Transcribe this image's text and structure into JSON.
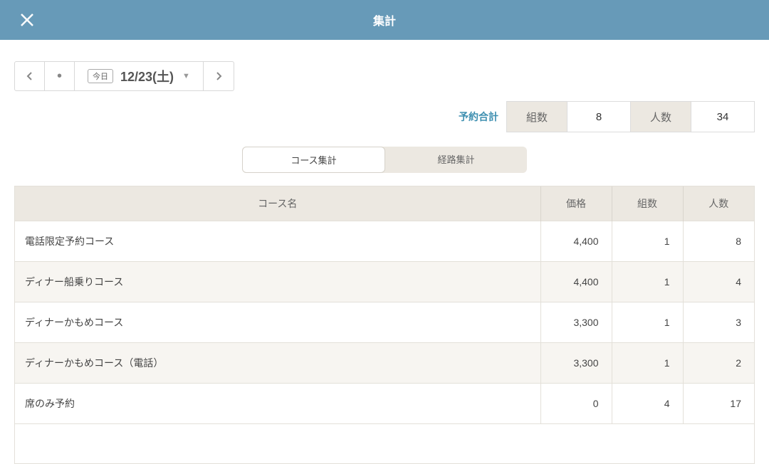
{
  "header": {
    "title": "集計"
  },
  "dateNav": {
    "todayBadge": "今日",
    "date": "12/23(土)"
  },
  "summary": {
    "label": "予約合計",
    "groupsLabel": "組数",
    "groupsValue": "8",
    "peopleLabel": "人数",
    "peopleValue": "34"
  },
  "tabs": {
    "course": "コース集計",
    "route": "経路集計"
  },
  "table": {
    "headers": {
      "courseName": "コース名",
      "price": "価格",
      "groups": "組数",
      "people": "人数"
    },
    "rows": [
      {
        "name": "電話限定予約コース",
        "price": "4,400",
        "groups": "1",
        "people": "8"
      },
      {
        "name": "ディナー船乗りコース",
        "price": "4,400",
        "groups": "1",
        "people": "4"
      },
      {
        "name": "ディナーかもめコース",
        "price": "3,300",
        "groups": "1",
        "people": "3"
      },
      {
        "name": "ディナーかもめコース（電話）",
        "price": "3,300",
        "groups": "1",
        "people": "2"
      },
      {
        "name": "席のみ予約",
        "price": "0",
        "groups": "4",
        "people": "17"
      }
    ]
  }
}
